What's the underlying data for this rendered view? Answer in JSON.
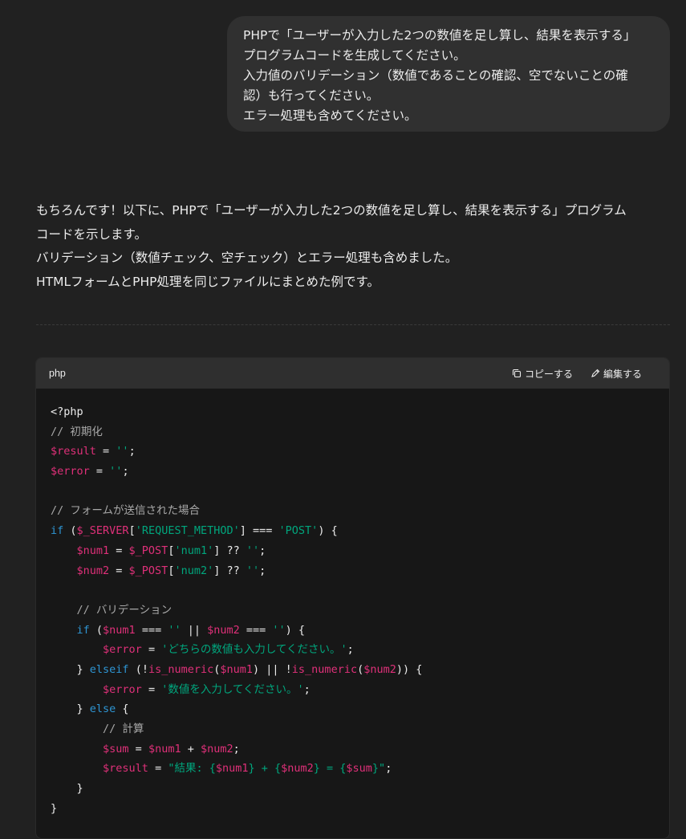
{
  "user_message": {
    "lines": [
      "PHPで「ユーザーが入力した2つの数値を足し算し、結果を表示する」",
      "プログラムコードを生成してください。",
      "入力値のバリデーション（数値であることの確認、空でないことの確",
      "認）も行ってください。",
      "エラー処理も含めてください。"
    ]
  },
  "assistant_message": {
    "lines": [
      "もちろんです！以下に、PHPで「ユーザーが入力した2つの数値を足し算し、結果を表示する」プログラム",
      "コードを示します。",
      "バリデーション（数値チェック、空チェック）とエラー処理も含めました。",
      "HTMLフォームとPHP処理を同じファイルにまとめた例です。"
    ]
  },
  "code_block": {
    "language": "php",
    "copy_label": "コピーする",
    "edit_label": "編集する",
    "lines": [
      [
        {
          "t": "pl",
          "v": "<?php"
        }
      ],
      [
        {
          "t": "cm",
          "v": "// 初期化"
        }
      ],
      [
        {
          "t": "var",
          "v": "$result"
        },
        {
          "t": "pl",
          "v": " = "
        },
        {
          "t": "str",
          "v": "''"
        },
        {
          "t": "pl",
          "v": ";"
        }
      ],
      [
        {
          "t": "var",
          "v": "$error"
        },
        {
          "t": "pl",
          "v": " = "
        },
        {
          "t": "str",
          "v": "''"
        },
        {
          "t": "pl",
          "v": ";"
        }
      ],
      [],
      [
        {
          "t": "cm",
          "v": "// フォームが送信された場合"
        }
      ],
      [
        {
          "t": "kw",
          "v": "if"
        },
        {
          "t": "pl",
          "v": " ("
        },
        {
          "t": "var",
          "v": "$_SERVER"
        },
        {
          "t": "pl",
          "v": "["
        },
        {
          "t": "str",
          "v": "'REQUEST_METHOD'"
        },
        {
          "t": "pl",
          "v": "] === "
        },
        {
          "t": "str",
          "v": "'POST'"
        },
        {
          "t": "pl",
          "v": ") {"
        }
      ],
      [
        {
          "t": "pl",
          "v": "    "
        },
        {
          "t": "var",
          "v": "$num1"
        },
        {
          "t": "pl",
          "v": " = "
        },
        {
          "t": "var",
          "v": "$_POST"
        },
        {
          "t": "pl",
          "v": "["
        },
        {
          "t": "str",
          "v": "'num1'"
        },
        {
          "t": "pl",
          "v": "] ?? "
        },
        {
          "t": "str",
          "v": "''"
        },
        {
          "t": "pl",
          "v": ";"
        }
      ],
      [
        {
          "t": "pl",
          "v": "    "
        },
        {
          "t": "var",
          "v": "$num2"
        },
        {
          "t": "pl",
          "v": " = "
        },
        {
          "t": "var",
          "v": "$_POST"
        },
        {
          "t": "pl",
          "v": "["
        },
        {
          "t": "str",
          "v": "'num2'"
        },
        {
          "t": "pl",
          "v": "] ?? "
        },
        {
          "t": "str",
          "v": "''"
        },
        {
          "t": "pl",
          "v": ";"
        }
      ],
      [],
      [
        {
          "t": "pl",
          "v": "    "
        },
        {
          "t": "cm",
          "v": "// バリデーション"
        }
      ],
      [
        {
          "t": "pl",
          "v": "    "
        },
        {
          "t": "kw",
          "v": "if"
        },
        {
          "t": "pl",
          "v": " ("
        },
        {
          "t": "var",
          "v": "$num1"
        },
        {
          "t": "pl",
          "v": " === "
        },
        {
          "t": "str",
          "v": "''"
        },
        {
          "t": "pl",
          "v": " || "
        },
        {
          "t": "var",
          "v": "$num2"
        },
        {
          "t": "pl",
          "v": " === "
        },
        {
          "t": "str",
          "v": "''"
        },
        {
          "t": "pl",
          "v": ") {"
        }
      ],
      [
        {
          "t": "pl",
          "v": "        "
        },
        {
          "t": "var",
          "v": "$error"
        },
        {
          "t": "pl",
          "v": " = "
        },
        {
          "t": "str",
          "v": "'どちらの数値も入力してください。'"
        },
        {
          "t": "pl",
          "v": ";"
        }
      ],
      [
        {
          "t": "pl",
          "v": "    } "
        },
        {
          "t": "kw",
          "v": "elseif"
        },
        {
          "t": "pl",
          "v": " (!"
        },
        {
          "t": "fn",
          "v": "is_numeric"
        },
        {
          "t": "pl",
          "v": "("
        },
        {
          "t": "var",
          "v": "$num1"
        },
        {
          "t": "pl",
          "v": ") || !"
        },
        {
          "t": "fn",
          "v": "is_numeric"
        },
        {
          "t": "pl",
          "v": "("
        },
        {
          "t": "var",
          "v": "$num2"
        },
        {
          "t": "pl",
          "v": ")) {"
        }
      ],
      [
        {
          "t": "pl",
          "v": "        "
        },
        {
          "t": "var",
          "v": "$error"
        },
        {
          "t": "pl",
          "v": " = "
        },
        {
          "t": "str",
          "v": "'数値を入力してください。'"
        },
        {
          "t": "pl",
          "v": ";"
        }
      ],
      [
        {
          "t": "pl",
          "v": "    } "
        },
        {
          "t": "kw",
          "v": "else"
        },
        {
          "t": "pl",
          "v": " {"
        }
      ],
      [
        {
          "t": "pl",
          "v": "        "
        },
        {
          "t": "cm",
          "v": "// 計算"
        }
      ],
      [
        {
          "t": "pl",
          "v": "        "
        },
        {
          "t": "var",
          "v": "$sum"
        },
        {
          "t": "pl",
          "v": " = "
        },
        {
          "t": "var",
          "v": "$num1"
        },
        {
          "t": "pl",
          "v": " + "
        },
        {
          "t": "var",
          "v": "$num2"
        },
        {
          "t": "pl",
          "v": ";"
        }
      ],
      [
        {
          "t": "pl",
          "v": "        "
        },
        {
          "t": "var",
          "v": "$result"
        },
        {
          "t": "pl",
          "v": " = "
        },
        {
          "t": "str",
          "v": "\"結果: {"
        },
        {
          "t": "var",
          "v": "$num1"
        },
        {
          "t": "str",
          "v": "} + {"
        },
        {
          "t": "var",
          "v": "$num2"
        },
        {
          "t": "str",
          "v": "} = {"
        },
        {
          "t": "var",
          "v": "$sum"
        },
        {
          "t": "str",
          "v": "}\""
        },
        {
          "t": "pl",
          "v": ";"
        }
      ],
      [
        {
          "t": "pl",
          "v": "    }"
        }
      ],
      [
        {
          "t": "pl",
          "v": "}"
        }
      ]
    ]
  },
  "colors": {
    "background": "#212121",
    "bubble": "#303030",
    "code_bg": "#171717",
    "code_header": "#2f2f2f",
    "variable": "#df3079",
    "string": "#00a67d",
    "keyword": "#2e95d3",
    "comment": "#a8a8a8"
  },
  "icons": {
    "copy": "copy-icon",
    "edit": "pencil-icon"
  }
}
